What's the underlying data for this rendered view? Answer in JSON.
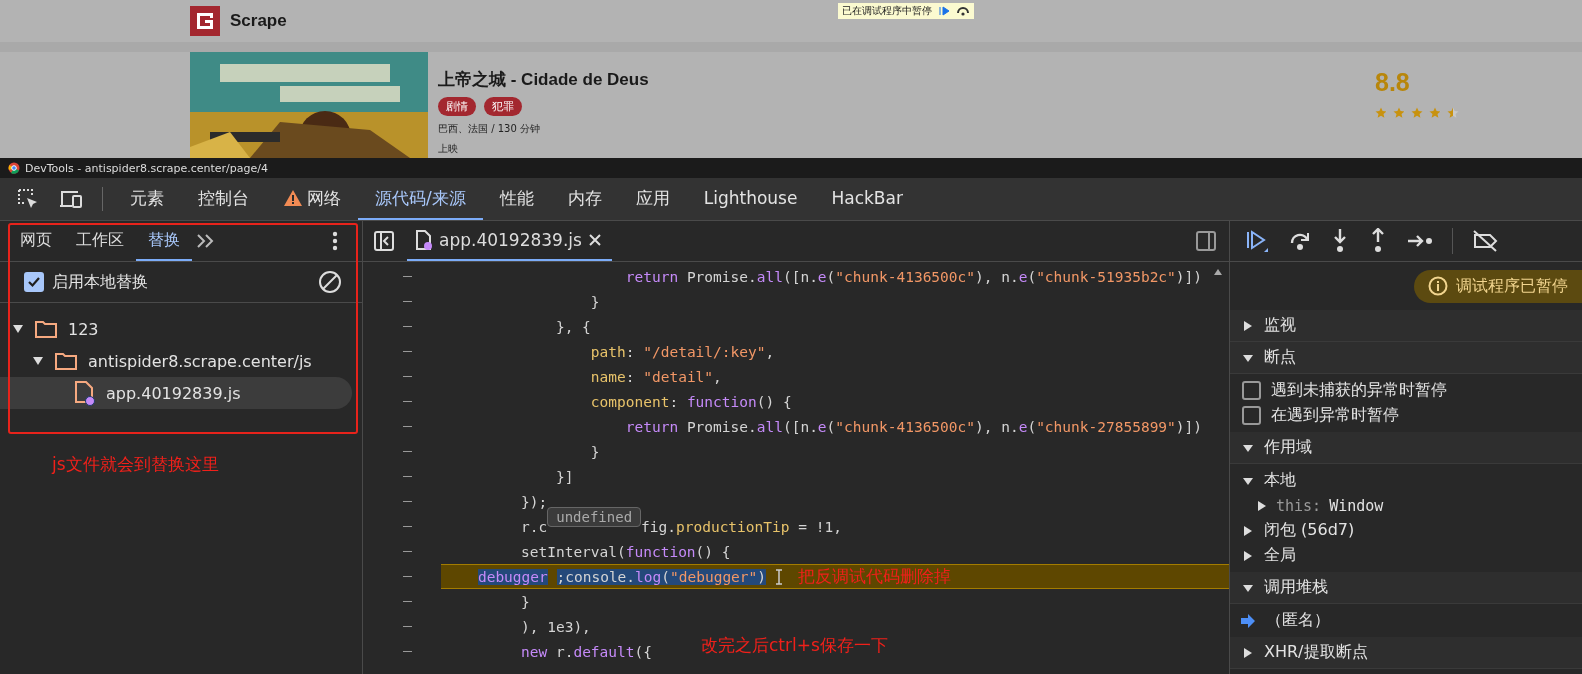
{
  "page": {
    "site_name": "Scrape",
    "debug_banner": {
      "text": "已在调试程序中暂停"
    },
    "movie": {
      "poster": {
        "kind": "picture"
      },
      "title": "上帝之城 - Cidade de Deus",
      "tags": [
        "剧情",
        "犯罪"
      ],
      "info": "巴西、法国 / 130 分钟",
      "release": "上映",
      "score": "8.8",
      "stars": 4.5
    }
  },
  "devtools": {
    "title": "DevTools - antispider8.scrape.center/page/4",
    "tabs": [
      {
        "label": "元素",
        "selected": false,
        "warning": false
      },
      {
        "label": "控制台",
        "selected": false,
        "warning": false
      },
      {
        "label": "网络",
        "selected": false,
        "warning": true
      },
      {
        "label": "源代码/来源",
        "selected": true,
        "warning": false
      },
      {
        "label": "性能",
        "selected": false,
        "warning": false
      },
      {
        "label": "内存",
        "selected": false,
        "warning": false
      },
      {
        "label": "应用",
        "selected": false,
        "warning": false
      },
      {
        "label": "Lighthouse",
        "selected": false,
        "warning": false
      },
      {
        "label": "HackBar",
        "selected": false,
        "warning": false
      }
    ],
    "navigator": {
      "tabs": [
        {
          "label": "网页",
          "selected": false
        },
        {
          "label": "工作区",
          "selected": false
        },
        {
          "label": "替换",
          "selected": true
        }
      ],
      "enable_overrides": {
        "label": "启用本地替换",
        "checked": true
      },
      "tree": [
        {
          "kind": "folder",
          "label": "123",
          "expanded": true,
          "selected": false,
          "children": [
            {
              "kind": "folder",
              "label": "antispider8.scrape.center/js",
              "expanded": true,
              "selected": false,
              "children": [
                {
                  "kind": "file",
                  "label": "app.40192839.js",
                  "selected": true
                }
              ]
            }
          ]
        }
      ]
    },
    "editor": {
      "tabs": [
        {
          "label": "app.40192839.js",
          "selected": true
        }
      ],
      "lines": [
        {
          "paused": false,
          "tokens": [
            {
              "kind": "keyword",
              "text": "            return"
            },
            {
              "kind": "plain",
              "text": " Promise."
            },
            {
              "kind": "method",
              "text": "all"
            },
            {
              "kind": "plain",
              "text": "([n."
            },
            {
              "kind": "method",
              "text": "e"
            },
            {
              "kind": "plain",
              "text": "("
            },
            {
              "kind": "string",
              "text": "\"chunk-4136500c\""
            },
            {
              "kind": "plain",
              "text": "), n."
            },
            {
              "kind": "method",
              "text": "e"
            },
            {
              "kind": "plain",
              "text": "("
            },
            {
              "kind": "string",
              "text": "\"chunk-51935b2c\""
            },
            {
              "kind": "plain",
              "text": ")])"
            }
          ]
        },
        {
          "paused": false,
          "tokens": [
            {
              "kind": "plain",
              "text": "        }"
            }
          ]
        },
        {
          "paused": false,
          "tokens": [
            {
              "kind": "plain",
              "text": "    }, {"
            }
          ]
        },
        {
          "paused": false,
          "tokens": [
            {
              "kind": "property",
              "text": "        path"
            },
            {
              "kind": "plain",
              "text": ": "
            },
            {
              "kind": "string",
              "text": "\"/detail/:key\""
            },
            {
              "kind": "plain",
              "text": ","
            }
          ]
        },
        {
          "paused": false,
          "tokens": [
            {
              "kind": "property",
              "text": "        name"
            },
            {
              "kind": "plain",
              "text": ": "
            },
            {
              "kind": "string",
              "text": "\"detail\""
            },
            {
              "kind": "plain",
              "text": ","
            }
          ]
        },
        {
          "paused": false,
          "tokens": [
            {
              "kind": "property",
              "text": "        component"
            },
            {
              "kind": "plain",
              "text": ": "
            },
            {
              "kind": "keyword",
              "text": "function"
            },
            {
              "kind": "plain",
              "text": "() {"
            }
          ]
        },
        {
          "paused": false,
          "tokens": [
            {
              "kind": "keyword",
              "text": "            return"
            },
            {
              "kind": "plain",
              "text": " Promise."
            },
            {
              "kind": "method",
              "text": "all"
            },
            {
              "kind": "plain",
              "text": "([n."
            },
            {
              "kind": "method",
              "text": "e"
            },
            {
              "kind": "plain",
              "text": "("
            },
            {
              "kind": "string",
              "text": "\"chunk-4136500c\""
            },
            {
              "kind": "plain",
              "text": "), n."
            },
            {
              "kind": "method",
              "text": "e"
            },
            {
              "kind": "plain",
              "text": "("
            },
            {
              "kind": "string",
              "text": "\"chunk-27855899\""
            },
            {
              "kind": "plain",
              "text": ")])"
            }
          ]
        },
        {
          "paused": false,
          "tokens": [
            {
              "kind": "plain",
              "text": "        }"
            }
          ]
        },
        {
          "paused": false,
          "tokens": [
            {
              "kind": "plain",
              "text": "    }]"
            }
          ]
        },
        {
          "paused": false,
          "tokens": [
            {
              "kind": "plain",
              "text": "});"
            }
          ]
        },
        {
          "paused": false,
          "tokens": [
            {
              "kind": "plain",
              "text": "r.c"
            },
            {
              "kind": "tooltip",
              "text": "undefined"
            },
            {
              "kind": "plain",
              "text": "fig."
            },
            {
              "kind": "property",
              "text": "productionTip"
            },
            {
              "kind": "plain",
              "text": " = !1,"
            }
          ]
        },
        {
          "paused": false,
          "tokens": [
            {
              "kind": "plain",
              "text": "setInterval("
            },
            {
              "kind": "keyword",
              "text": "function"
            },
            {
              "kind": "plain",
              "text": "() {"
            }
          ]
        },
        {
          "paused": true,
          "tokens": [
            {
              "kind": "keyword",
              "text": "    debugger"
            },
            {
              "kind": "plain",
              "text": " ;console."
            },
            {
              "kind": "method",
              "text": "log"
            },
            {
              "kind": "plain",
              "text": "("
            },
            {
              "kind": "string",
              "text": "\"debugger\""
            },
            {
              "kind": "plain",
              "text": ")"
            }
          ]
        },
        {
          "paused": false,
          "tokens": [
            {
              "kind": "plain",
              "text": "}"
            }
          ]
        },
        {
          "paused": false,
          "tokens": [
            {
              "kind": "plain",
              "text": "), 1e3),"
            }
          ]
        },
        {
          "paused": false,
          "tokens": [
            {
              "kind": "keyword",
              "text": "new"
            },
            {
              "kind": "plain",
              "text": " r."
            },
            {
              "kind": "method",
              "text": "default"
            },
            {
              "kind": "plain",
              "text": "({"
            }
          ]
        }
      ]
    },
    "debugger": {
      "paused_message": "调试程序已暂停",
      "sections": [
        {
          "title": "监视",
          "expanded": false
        },
        {
          "title": "断点",
          "expanded": true,
          "items": [
            {
              "kind": "checkbox",
              "label": "遇到未捕获的异常时暂停",
              "checked": false
            },
            {
              "kind": "checkbox",
              "label": "在遇到异常时暂停",
              "checked": false
            }
          ]
        },
        {
          "title": "作用域",
          "expanded": true,
          "items": [
            {
              "kind": "scope",
              "label": "本地",
              "expanded": true,
              "children": [
                {
                  "kind": "property",
                  "name": "this:",
                  "value": "Window",
                  "expanded": false
                }
              ]
            },
            {
              "kind": "scope",
              "label": "闭包 (56d7)",
              "expanded": false
            },
            {
              "kind": "scope",
              "label": "全局",
              "expanded": false
            }
          ]
        },
        {
          "title": "调用堆栈",
          "expanded": true,
          "items": [
            {
              "kind": "frame",
              "label": "（匿名）",
              "current": true
            }
          ]
        },
        {
          "title": "XHR/提取断点",
          "expanded": false
        }
      ]
    }
  },
  "annotations": [
    {
      "kind": "sidebar",
      "text": "js文件就会到替换这里"
    },
    {
      "kind": "line",
      "text": "把反调试代码删除掉"
    },
    {
      "kind": "bottom",
      "text": "改完之后ctrl+s保存一下"
    }
  ]
}
